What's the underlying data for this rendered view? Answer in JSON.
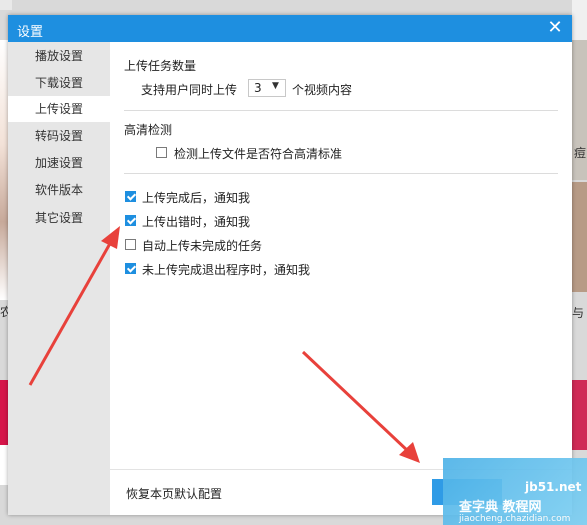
{
  "dialog": {
    "title": "设置",
    "close_icon": "close-icon"
  },
  "sidebar": {
    "items": [
      {
        "label": "播放设置",
        "active": false
      },
      {
        "label": "下载设置",
        "active": false
      },
      {
        "label": "上传设置",
        "active": true
      },
      {
        "label": "转码设置",
        "active": false
      },
      {
        "label": "加速设置",
        "active": false
      },
      {
        "label": "软件版本",
        "active": false
      },
      {
        "label": "其它设置",
        "active": false
      }
    ]
  },
  "upload": {
    "task_count_title": "上传任务数量",
    "concurrent_prefix": "支持用户同时上传",
    "concurrent_value": "3",
    "concurrent_suffix": "个视频内容",
    "hd_title": "高清检测",
    "hd_check_label": "检测上传文件是否符合高清标准",
    "hd_check_checked": false,
    "options": [
      {
        "label": "上传完成后，通知我",
        "checked": true
      },
      {
        "label": "上传出错时，通知我",
        "checked": true
      },
      {
        "label": "自动上传未完成的任务",
        "checked": false
      },
      {
        "label": "未上传完成退出程序时，通知我",
        "checked": true
      }
    ]
  },
  "footer": {
    "restore_label": "恢复本页默认配置"
  },
  "background": {
    "right_text_1": "痘",
    "right_text_2": "与",
    "left_text": "农"
  },
  "watermark": {
    "site": "jb51.net",
    "title": "查字典 教程网",
    "url": "jiaocheng.chazidian.com"
  },
  "colors": {
    "accent": "#1e8fe0",
    "arrow": "#e8413b"
  }
}
